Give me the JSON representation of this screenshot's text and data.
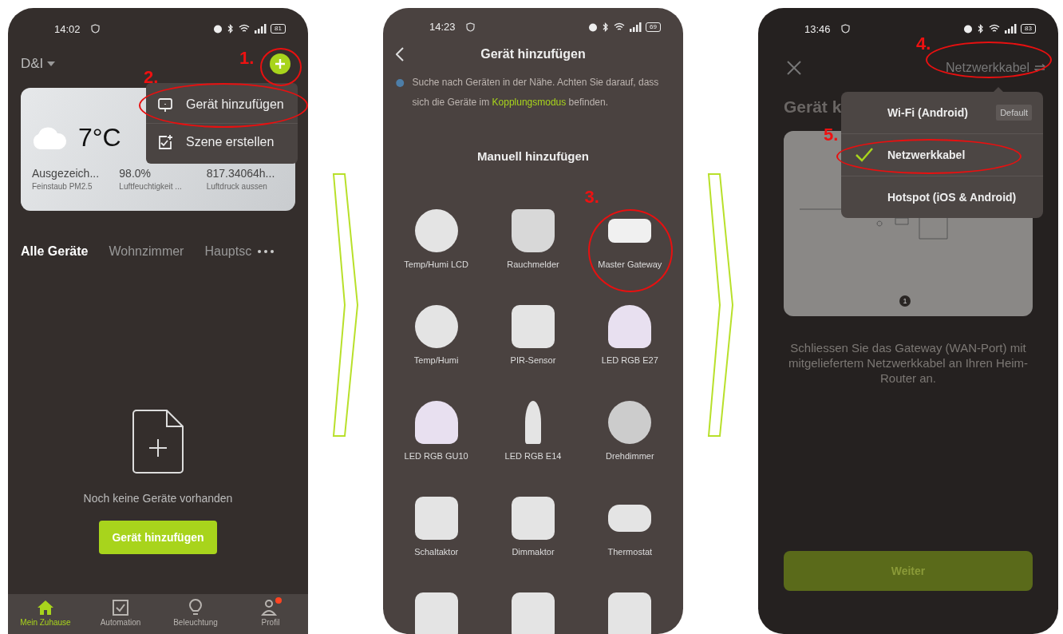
{
  "home_screen": {
    "status_bar": {
      "time": "14:02",
      "battery": "81"
    },
    "home_name": "D&I",
    "add_marker": "1.",
    "add_highlighted": true,
    "menu": {
      "marker": "2.",
      "items": [
        {
          "kind": "device",
          "label": "Gerät hinzufügen",
          "highlighted": true
        },
        {
          "kind": "scene",
          "label": "Szene erstellen",
          "highlighted": false
        }
      ]
    },
    "weather": {
      "temperature": "7°C",
      "metrics": [
        {
          "value": "Ausgezeich...",
          "label": "Feinstaub PM2.5"
        },
        {
          "value": "98.0%",
          "label": "Luftfeuchtigkeit ..."
        },
        {
          "value": "817.34064h...",
          "label": "Luftdruck aussen"
        }
      ]
    },
    "tabs": [
      {
        "label": "Alle Geräte",
        "selected": true
      },
      {
        "label": "Wohnzimmer",
        "selected": false
      },
      {
        "label": "Hauptsc",
        "selected": false
      }
    ],
    "empty_text": "Noch keine Geräte vorhanden",
    "add_button": "Gerät hinzufügen",
    "nav": [
      {
        "kind": "home",
        "label": "Mein Zuhause",
        "selected": true,
        "badge": false
      },
      {
        "kind": "automation",
        "label": "Automation",
        "selected": false,
        "badge": false
      },
      {
        "kind": "light",
        "label": "Beleuchtung",
        "selected": false,
        "badge": false
      },
      {
        "kind": "profile",
        "label": "Profil",
        "selected": false,
        "badge": true
      }
    ]
  },
  "add_device_screen": {
    "status_bar": {
      "time": "14:23",
      "battery": "69"
    },
    "title": "Gerät hinzufügen",
    "hint": {
      "before": "Suche nach Geräten in der Nähe. Achten Sie darauf, dass sich die Geräte im",
      "link": "Kopplungsmodus",
      "after": "befinden."
    },
    "section_title": "Manuell hinzufügen",
    "devices": [
      {
        "kind": "sensor",
        "label": "Temp/Humi LCD",
        "highlighted": false
      },
      {
        "kind": "smoke",
        "label": "Rauchmelder",
        "highlighted": false
      },
      {
        "kind": "gateway",
        "label": "Master Gateway",
        "highlighted": true,
        "marker": "3."
      },
      {
        "kind": "sensor",
        "label": "Temp/Humi",
        "highlighted": false
      },
      {
        "kind": "pir",
        "label": "PIR-Sensor",
        "highlighted": false
      },
      {
        "kind": "bulb",
        "label": "LED RGB E27",
        "highlighted": false
      },
      {
        "kind": "spot",
        "label": "LED RGB GU10",
        "highlighted": false
      },
      {
        "kind": "candle",
        "label": "LED RGB E14",
        "highlighted": false
      },
      {
        "kind": "dimmer",
        "label": "Drehdimmer",
        "highlighted": false
      },
      {
        "kind": "module",
        "label": "Schaltaktor",
        "highlighted": false
      },
      {
        "kind": "module",
        "label": "Dimmaktor",
        "highlighted": false
      },
      {
        "kind": "thermostat",
        "label": "Thermostat",
        "highlighted": false
      }
    ]
  },
  "gateway_screen": {
    "status_bar": {
      "time": "13:46",
      "battery": "83"
    },
    "mode_label": "Netzwerkkabel",
    "mode_marker": "4.",
    "mode_highlighted": true,
    "dropdown_open": true,
    "title": "Gerät k",
    "illustration_step": "1",
    "options": [
      {
        "label": "Wi-Fi (Android)",
        "selected": false,
        "badge": "Default"
      },
      {
        "label": "Netzwerkkabel",
        "selected": true,
        "marker": "5."
      },
      {
        "label": "Hotspot (iOS & Android)",
        "selected": false
      }
    ],
    "instructions": "Schliessen Sie das Gateway (WAN-Port) mit mitgeliefertem Netzwerkkabel an Ihren Heim-Router an.",
    "next_button": {
      "label": "Weiter",
      "disabled": true
    }
  }
}
